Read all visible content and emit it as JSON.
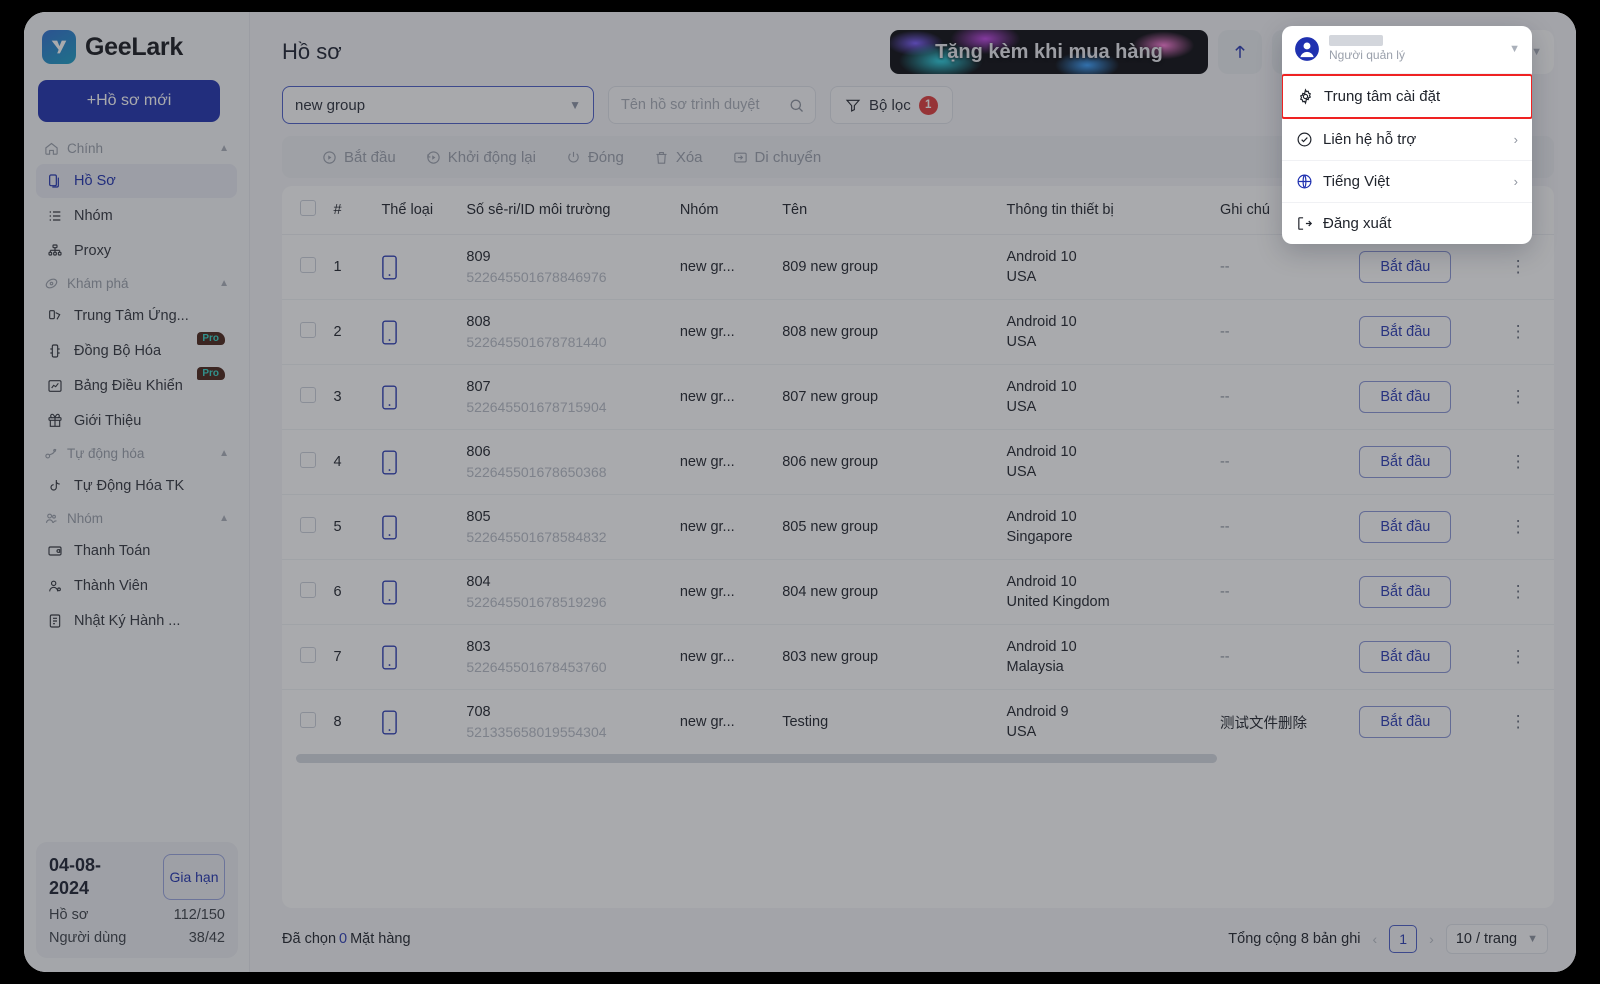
{
  "sidebar": {
    "brand": "GeeLark",
    "new_profile_button": "+Hồ sơ mới",
    "groups": [
      {
        "label": "Chính",
        "icon": "home-icon",
        "items": [
          {
            "label": "Hồ Sơ",
            "icon": "profile-icon",
            "active": true
          },
          {
            "label": "Nhóm",
            "icon": "list-icon",
            "active": false
          },
          {
            "label": "Proxy",
            "icon": "proxy-icon",
            "active": false
          }
        ]
      },
      {
        "label": "Khám phá",
        "icon": "compass-icon",
        "items": [
          {
            "label": "Trung Tâm Ứng...",
            "icon": "apps-icon",
            "badge": ""
          },
          {
            "label": "Đồng Bộ Hóa",
            "icon": "sync-icon",
            "badge": "Pro"
          },
          {
            "label": "Bảng Điều Khiển",
            "icon": "dashboard-icon",
            "badge": "Pro"
          },
          {
            "label": "Giới Thiệu",
            "icon": "gift-icon",
            "badge": ""
          }
        ]
      },
      {
        "label": "Tự động hóa",
        "icon": "automation-icon",
        "items": [
          {
            "label": "Tự Động Hóa TK",
            "icon": "tiktok-icon",
            "badge": ""
          }
        ]
      },
      {
        "label": "Nhóm",
        "icon": "team-icon",
        "items": [
          {
            "label": "Thanh Toán",
            "icon": "billing-icon",
            "badge": ""
          },
          {
            "label": "Thành Viên",
            "icon": "member-icon",
            "badge": ""
          },
          {
            "label": "Nhật Ký Hành ...",
            "icon": "log-icon",
            "badge": ""
          }
        ]
      }
    ],
    "plan": {
      "date": "04-08-2024",
      "renew_button": "Gia hạn",
      "profiles_label": "Hồ sơ",
      "profiles_value": "112/150",
      "users_label": "Người dùng",
      "users_value": "38/42"
    }
  },
  "header": {
    "title": "Hồ sơ",
    "promo_banner": "Tặng kèm khi mua hàng",
    "upload_icon": "upload-arrow-icon",
    "bell_icon": "notification-bell-icon",
    "user": {
      "name_redacted": true,
      "role": "Người quản lý"
    }
  },
  "toolbar": {
    "group_select_value": "new group",
    "search_placeholder": "Tên hồ sơ trình duyệt",
    "search_value": "",
    "filter_label": "Bộ lọc",
    "filter_count": "1"
  },
  "action_bar": [
    {
      "label": "Bắt đầu",
      "icon": "play-circle-icon"
    },
    {
      "label": "Khởi động lại",
      "icon": "restart-icon"
    },
    {
      "label": "Đóng",
      "icon": "power-icon"
    },
    {
      "label": "Xóa",
      "icon": "trash-icon"
    },
    {
      "label": "Di chuyển",
      "icon": "move-icon"
    }
  ],
  "table": {
    "columns": [
      "#",
      "Thể loại",
      "Số sê-ri/ID môi trường",
      "Nhóm",
      "Tên",
      "Thông tin thiết bị",
      "Ghi chú",
      "",
      ""
    ],
    "rows": [
      {
        "idx": "1",
        "type_icon": "phone-icon",
        "serial": "809",
        "env_id": "522645501678846976",
        "group": "new gr...",
        "name": "809 new group",
        "os": "Android 10",
        "country": "USA",
        "note": "--",
        "action": "Bắt đầu"
      },
      {
        "idx": "2",
        "type_icon": "phone-icon",
        "serial": "808",
        "env_id": "522645501678781440",
        "group": "new gr...",
        "name": "808 new group",
        "os": "Android 10",
        "country": "USA",
        "note": "--",
        "action": "Bắt đầu"
      },
      {
        "idx": "3",
        "type_icon": "phone-icon",
        "serial": "807",
        "env_id": "522645501678715904",
        "group": "new gr...",
        "name": "807 new group",
        "os": "Android 10",
        "country": "USA",
        "note": "--",
        "action": "Bắt đầu"
      },
      {
        "idx": "4",
        "type_icon": "phone-icon",
        "serial": "806",
        "env_id": "522645501678650368",
        "group": "new gr...",
        "name": "806 new group",
        "os": "Android 10",
        "country": "USA",
        "note": "--",
        "action": "Bắt đầu"
      },
      {
        "idx": "5",
        "type_icon": "phone-icon",
        "serial": "805",
        "env_id": "522645501678584832",
        "group": "new gr...",
        "name": "805 new group",
        "os": "Android 10",
        "country": "Singapore",
        "note": "--",
        "action": "Bắt đầu"
      },
      {
        "idx": "6",
        "type_icon": "phone-icon",
        "serial": "804",
        "env_id": "522645501678519296",
        "group": "new gr...",
        "name": "804 new group",
        "os": "Android 10",
        "country": "United Kingdom",
        "note": "--",
        "action": "Bắt đầu"
      },
      {
        "idx": "7",
        "type_icon": "phone-icon",
        "serial": "803",
        "env_id": "522645501678453760",
        "group": "new gr...",
        "name": "803 new group",
        "os": "Android 10",
        "country": "Malaysia",
        "note": "--",
        "action": "Bắt đầu"
      },
      {
        "idx": "8",
        "type_icon": "phone-icon",
        "serial": "708",
        "env_id": "521335658019554304",
        "group": "new gr...",
        "name": "Testing",
        "os": "Android 9",
        "country": "USA",
        "note": "测试文件删除",
        "action": "Bắt đầu"
      }
    ]
  },
  "footer": {
    "selected_prefix": "Đã chọn",
    "selected_count": "0",
    "selected_suffix": "Mặt hàng",
    "total_text": "Tổng cộng 8 bản ghi",
    "current_page": "1",
    "per_page": "10 / trang"
  },
  "popup_menu": {
    "items": [
      {
        "label": "Trung tâm cài đặt",
        "icon": "gear-icon",
        "arrow": "",
        "highlighted": true
      },
      {
        "label": "Liên hệ hỗ trợ",
        "icon": "support-icon",
        "arrow": "›",
        "highlighted": false
      },
      {
        "label": "Tiếng Việt",
        "icon": "globe-icon",
        "arrow": "›",
        "highlighted": false
      },
      {
        "label": "Đăng xuất",
        "icon": "logout-icon",
        "arrow": "",
        "highlighted": false
      }
    ]
  },
  "colors": {
    "brand_blue": "#1f31b0",
    "accent_link": "#2b3bb5",
    "danger_red": "#e03b3b",
    "highlight_red": "#ef2222",
    "pro_badge_teal": "#38d6c9"
  }
}
